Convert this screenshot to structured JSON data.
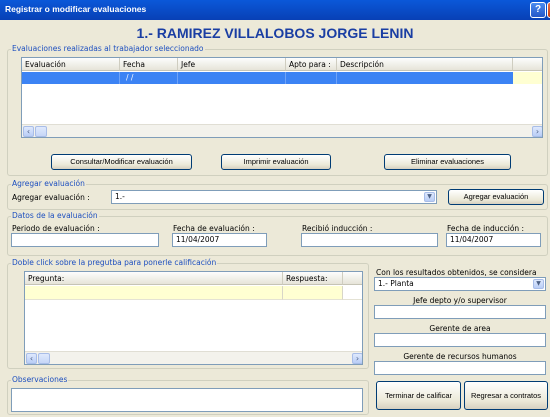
{
  "window": {
    "title": "Registrar o modificar evaluaciones",
    "help_icon": "?",
    "close_icon": "×"
  },
  "worker_name": "1.- RAMIREZ VILLALOBOS JORGE LENIN",
  "evaluations_group": {
    "legend": "Evaluaciones realizadas al trabajador seleccionado",
    "columns": [
      "Evaluación",
      "Fecha",
      "Jefe",
      "Apto para :",
      "Descripción"
    ],
    "rows": [
      {
        "evaluacion": "",
        "fecha": "/ /",
        "jefe": "",
        "apto": "",
        "descripcion": ""
      }
    ],
    "buttons": {
      "consult": "Consultar/Modificar evaluación",
      "print": "Imprimir evaluación",
      "delete": "Eliminar evaluaciones"
    }
  },
  "add_group": {
    "legend": "Agregar evaluación",
    "label": "Agregar evaluación :",
    "selected": "1.-",
    "button": "Agregar evaluación"
  },
  "data_group": {
    "legend": "Datos de la evaluación",
    "period_label": "Periodo de evaluación :",
    "period_value": "",
    "eval_date_label": "Fecha de evaluación :",
    "eval_date_value": "11/04/2007",
    "induction_label": "Recibió inducción :",
    "induction_value": "",
    "induction_date_label": "Fecha de inducción :",
    "induction_date_value": "11/04/2007"
  },
  "questions_group": {
    "legend": "Doble click sobre la pregutba para ponerle calificación",
    "columns": [
      "Pregunta:",
      "Respuesta:"
    ]
  },
  "results": {
    "label": "Con los resultados obtenidos, se considera apto :",
    "selected": "1.- Planta",
    "supervisor_label": "Jefe depto y/o supervisor",
    "supervisor_value": "",
    "area_manager_label": "Gerente de area",
    "area_manager_value": "",
    "hr_manager_label": "Gerente de recursos humanos",
    "hr_manager_value": ""
  },
  "observations": {
    "legend": "Observaciones",
    "value": ""
  },
  "footer_buttons": {
    "finish": "Terminar de calificar",
    "back": "Regresar a contratos"
  },
  "colors": {
    "titlebar": "#0a58d9",
    "name": "#1a3ea3",
    "legend": "#1d4fbf",
    "selected_row": "#3c83f4",
    "question_row": "#ffffd2"
  }
}
